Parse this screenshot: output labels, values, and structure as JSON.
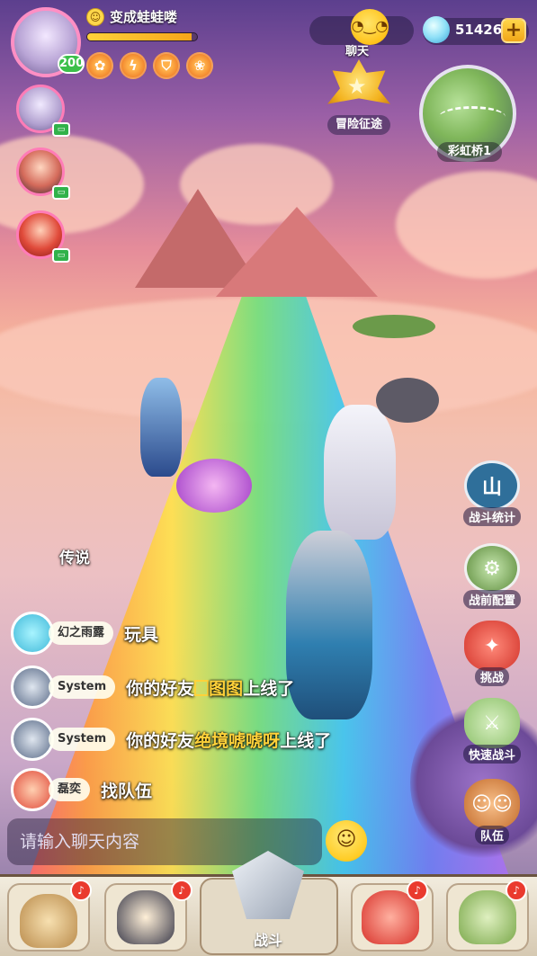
{
  "player": {
    "name": "变成蛙蛙喽",
    "level": "200",
    "xp_fraction": 0.95,
    "buffs": [
      "buff-orange-icon",
      "buff-bolt-icon",
      "buff-shield-icon",
      "buff-paw-icon"
    ]
  },
  "header": {
    "chat_label": "聊天",
    "gems": "51426",
    "add_symbol": "+",
    "adventure_label": "冒险征途",
    "map_label": "彩虹桥1"
  },
  "side_buttons": [
    {
      "label": "战斗统计",
      "icon": "stats-icon"
    },
    {
      "label": "战前配置",
      "icon": "config-icon"
    },
    {
      "label": "挑战",
      "icon": "challenge-icon"
    },
    {
      "label": "快速战斗",
      "icon": "quick-battle-icon"
    },
    {
      "label": "队伍",
      "icon": "team-icon"
    }
  ],
  "chat": {
    "messages": [
      {
        "sender": "幻之雨露",
        "text": "传说"
      },
      {
        "sender": "幻之雨露",
        "text": "玩具"
      },
      {
        "sender": "System",
        "text_prefix": "你的好友",
        "highlight": "图图",
        "text_suffix": "上线了"
      },
      {
        "sender": "System",
        "text_prefix": "你的好友",
        "highlight": "绝境唬唬呀",
        "text_suffix": "上线了"
      },
      {
        "sender": "磊奕",
        "text": "找队伍"
      }
    ],
    "input_placeholder": "请输入聊天内容"
  },
  "bottom_nav": {
    "active_label": "战斗"
  }
}
